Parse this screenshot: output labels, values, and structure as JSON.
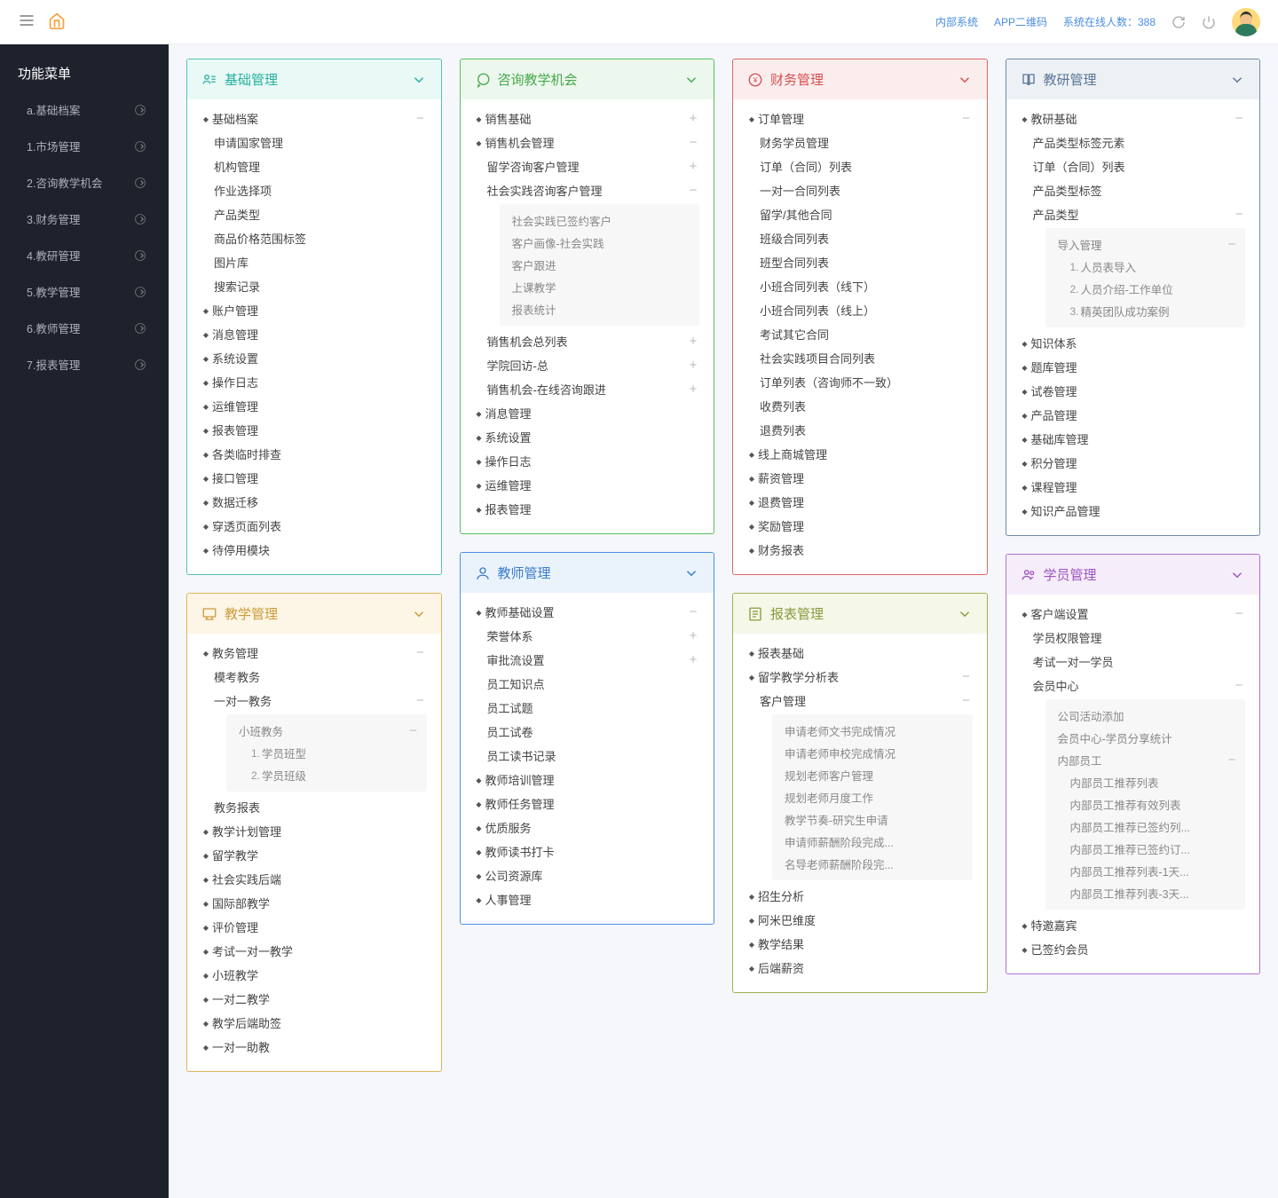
{
  "topbar": {
    "links": [
      "内部系统",
      "APP二维码"
    ],
    "online": "系统在线人数：388"
  },
  "sidebar": {
    "title": "功能菜单",
    "items": [
      "a.基础档案",
      "1.市场管理",
      "2.咨询教学机会",
      "3.财务管理",
      "4.教研管理",
      "5.教学管理",
      "6.教师管理",
      "7.报表管理"
    ]
  },
  "cards": [
    {
      "id": "basic",
      "title": "基础管理",
      "color": "teal",
      "icon": "user-list",
      "tree": [
        {
          "label": "基础档案",
          "toggle": "-",
          "children": [
            {
              "label": "申请国家管理"
            },
            {
              "label": "机构管理"
            },
            {
              "label": "作业选择项"
            },
            {
              "label": "产品类型"
            },
            {
              "label": "商品价格范围标签"
            },
            {
              "label": "图片库"
            },
            {
              "label": "搜索记录"
            }
          ]
        },
        {
          "label": "账户管理"
        },
        {
          "label": "消息管理"
        },
        {
          "label": "系统设置"
        },
        {
          "label": "操作日志"
        },
        {
          "label": "运维管理"
        },
        {
          "label": "报表管理"
        },
        {
          "label": "各类临时排查"
        },
        {
          "label": "接口管理"
        },
        {
          "label": "数据迁移"
        },
        {
          "label": "穿透页面列表"
        },
        {
          "label": "待停用模块"
        }
      ]
    },
    {
      "id": "teaching",
      "title": "教学管理",
      "color": "yellow",
      "icon": "teach",
      "tree": [
        {
          "label": "教务管理",
          "toggle": "-",
          "children": [
            {
              "label": "模考教务"
            },
            {
              "label": "一对一教务",
              "toggle": "-",
              "box": [
                {
                  "label": "小班教务",
                  "toggle": "-",
                  "children": [
                    {
                      "ord": "1.",
                      "label": "学员班型"
                    },
                    {
                      "ord": "2.",
                      "label": "学员班级"
                    }
                  ]
                }
              ]
            },
            {
              "label": "教务报表"
            }
          ]
        },
        {
          "label": "教学计划管理"
        },
        {
          "label": "留学教学"
        },
        {
          "label": "社会实践后端"
        },
        {
          "label": "国际部教学"
        },
        {
          "label": "评价管理"
        },
        {
          "label": "考试一对一教学"
        },
        {
          "label": "小班教学"
        },
        {
          "label": "一对二教学"
        },
        {
          "label": "教学后端助签"
        },
        {
          "label": "一对一助教"
        }
      ]
    },
    {
      "id": "consult",
      "title": "咨询教学机会",
      "color": "green",
      "icon": "chat",
      "tree": [
        {
          "label": "销售基础",
          "toggle": "+"
        },
        {
          "label": "销售机会管理",
          "toggle": "-",
          "children": [
            {
              "label": "留学咨询客户管理",
              "toggle": "+"
            },
            {
              "label": "社会实践咨询客户管理",
              "toggle": "-",
              "box": [
                {
                  "label": "社会实践已签约客户"
                },
                {
                  "label": "客户画像-社会实践"
                },
                {
                  "label": "客户跟进"
                },
                {
                  "label": "上课教学"
                },
                {
                  "label": "报表统计"
                }
              ]
            },
            {
              "label": "销售机会总列表",
              "toggle": "+"
            },
            {
              "label": "学院回访-总",
              "toggle": "+"
            },
            {
              "label": "销售机会-在线咨询跟进",
              "toggle": "+"
            }
          ]
        },
        {
          "label": "消息管理"
        },
        {
          "label": "系统设置"
        },
        {
          "label": "操作日志"
        },
        {
          "label": "运维管理"
        },
        {
          "label": "报表管理"
        }
      ]
    },
    {
      "id": "teacher",
      "title": "教师管理",
      "color": "blue",
      "icon": "person",
      "tree": [
        {
          "label": "教师基础设置",
          "toggle": "-",
          "children": [
            {
              "label": "荣誉体系",
              "toggle": "+"
            },
            {
              "label": "审批流设置",
              "toggle": "+"
            },
            {
              "label": "员工知识点"
            },
            {
              "label": "员工试题"
            },
            {
              "label": "员工试卷"
            },
            {
              "label": "员工读书记录"
            }
          ]
        },
        {
          "label": "教师培训管理"
        },
        {
          "label": "教师任务管理"
        },
        {
          "label": "优质服务"
        },
        {
          "label": "教师读书打卡"
        },
        {
          "label": "公司资源库"
        },
        {
          "label": "人事管理"
        }
      ]
    },
    {
      "id": "finance",
      "title": "财务管理",
      "color": "red",
      "icon": "coin",
      "tree": [
        {
          "label": "订单管理",
          "toggle": "-",
          "children": [
            {
              "label": "财务学员管理"
            },
            {
              "label": "订单（合同）列表"
            },
            {
              "label": "一对一合同列表"
            },
            {
              "label": "留学/其他合同"
            },
            {
              "label": "班级合同列表"
            },
            {
              "label": "班型合同列表"
            },
            {
              "label": "小班合同列表（线下）"
            },
            {
              "label": "小班合同列表（线上）"
            },
            {
              "label": "考试其它合同"
            },
            {
              "label": "社会实践项目合同列表"
            },
            {
              "label": "订单列表（咨询师不一致）"
            },
            {
              "label": "收费列表"
            },
            {
              "label": "退费列表"
            }
          ]
        },
        {
          "label": "线上商城管理"
        },
        {
          "label": "薪资管理"
        },
        {
          "label": "退费管理"
        },
        {
          "label": "奖励管理"
        },
        {
          "label": "财务报表"
        }
      ]
    },
    {
      "id": "report",
      "title": "报表管理",
      "color": "olive",
      "icon": "report",
      "tree": [
        {
          "label": "报表基础"
        },
        {
          "label": "留学教学分析表",
          "toggle": "-",
          "children": [
            {
              "label": "客户管理",
              "toggle": "-",
              "box": [
                {
                  "label": "申请老师文书完成情况"
                },
                {
                  "label": "申请老师申校完成情况"
                },
                {
                  "label": "规划老师客户管理"
                },
                {
                  "label": "规划老师月度工作"
                },
                {
                  "label": "教学节奏-研究生申请"
                },
                {
                  "label": "申请师薪酬阶段完成..."
                },
                {
                  "label": "名导老师薪酬阶段完..."
                }
              ]
            }
          ]
        },
        {
          "label": "招生分析"
        },
        {
          "label": "阿米巴维度"
        },
        {
          "label": "教学结果"
        },
        {
          "label": "后端薪资"
        }
      ]
    },
    {
      "id": "research",
      "title": "教研管理",
      "color": "slate",
      "icon": "book",
      "tree": [
        {
          "label": "教研基础",
          "toggle": "-",
          "children": [
            {
              "label": "产品类型标签元素"
            },
            {
              "label": "订单（合同）列表"
            },
            {
              "label": "产品类型标签"
            },
            {
              "label": "产品类型",
              "toggle": "-",
              "box": [
                {
                  "label": "导入管理",
                  "toggle": "-",
                  "children": [
                    {
                      "ord": "1.",
                      "label": "人员表导入"
                    },
                    {
                      "ord": "2.",
                      "label": "人员介绍-工作单位"
                    },
                    {
                      "ord": "3.",
                      "label": "精英团队成功案例"
                    }
                  ]
                }
              ]
            }
          ]
        },
        {
          "label": "知识体系"
        },
        {
          "label": "题库管理"
        },
        {
          "label": "试卷管理"
        },
        {
          "label": "产品管理"
        },
        {
          "label": "基础库管理"
        },
        {
          "label": "积分管理"
        },
        {
          "label": "课程管理"
        },
        {
          "label": "知识产品管理"
        }
      ]
    },
    {
      "id": "student",
      "title": "学员管理",
      "color": "purple",
      "icon": "people",
      "tree": [
        {
          "label": "客户端设置",
          "toggle": "-",
          "children": [
            {
              "label": "学员权限管理"
            },
            {
              "label": "考试一对一学员"
            },
            {
              "label": "会员中心",
              "toggle": "-",
              "box": [
                {
                  "label": "公司活动添加"
                },
                {
                  "label": "会员中心-学员分享统计"
                },
                {
                  "label": "内部员工",
                  "toggle": "-",
                  "children": [
                    {
                      "label": "内部员工推荐列表"
                    },
                    {
                      "label": "内部员工推荐有效列表"
                    },
                    {
                      "label": "内部员工推荐已签约列..."
                    },
                    {
                      "label": "内部员工推荐已签约订..."
                    },
                    {
                      "label": "内部员工推荐列表-1天..."
                    },
                    {
                      "label": "内部员工推荐列表-3天..."
                    }
                  ]
                }
              ]
            }
          ]
        },
        {
          "label": "特邀嘉宾"
        },
        {
          "label": "已签约会员"
        }
      ]
    }
  ]
}
